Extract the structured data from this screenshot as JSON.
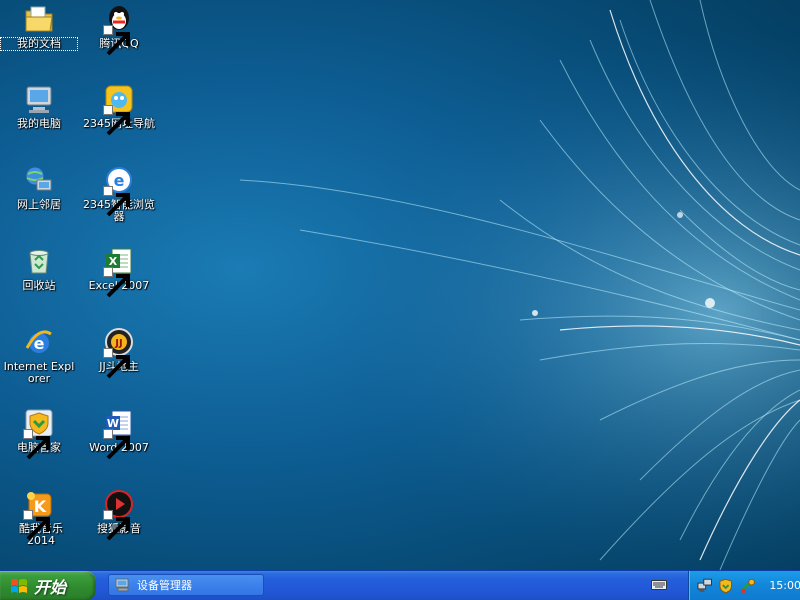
{
  "desktop": {
    "icons": [
      {
        "label": "我的文档"
      },
      {
        "label": "我的电脑"
      },
      {
        "label": "网上邻居"
      },
      {
        "label": "回收站"
      },
      {
        "label": "Internet Explorer"
      },
      {
        "label": "电脑管家"
      },
      {
        "label": "酷我音乐2014"
      },
      {
        "label": "腾讯QQ"
      },
      {
        "label": "2345网址导航"
      },
      {
        "label": "2345智能浏览器"
      },
      {
        "label": "Excel 2007"
      },
      {
        "label": "JJ斗地主"
      },
      {
        "label": "Word 2007"
      },
      {
        "label": "搜狐影音"
      }
    ]
  },
  "taskbar": {
    "start_label": "开始",
    "tasks": [
      {
        "label": "设备管理器"
      }
    ],
    "clock": "15:00"
  }
}
